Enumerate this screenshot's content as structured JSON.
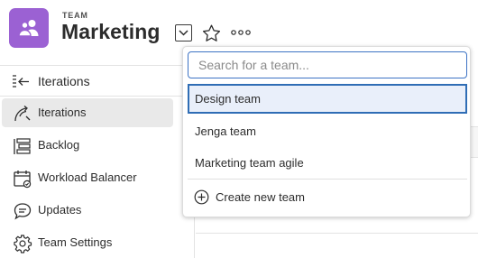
{
  "header": {
    "kicker": "TEAM",
    "title": "Marketing",
    "avatar_color": "#9b61d3"
  },
  "sidebar": {
    "heading": "Iterations",
    "items": [
      {
        "label": "Iterations",
        "icon": "iterations-icon",
        "active": true
      },
      {
        "label": "Backlog",
        "icon": "backlog-icon",
        "active": false
      },
      {
        "label": "Workload Balancer",
        "icon": "calendar-check-icon",
        "active": false
      },
      {
        "label": "Updates",
        "icon": "speech-bubble-icon",
        "active": false
      },
      {
        "label": "Team Settings",
        "icon": "gear-icon",
        "active": false
      }
    ]
  },
  "team_picker": {
    "search_placeholder": "Search for a team...",
    "options": [
      {
        "label": "Design team",
        "selected": true
      },
      {
        "label": "Jenga team",
        "selected": false
      },
      {
        "label": "Marketing team agile",
        "selected": false
      }
    ],
    "create_label": "Create new team"
  },
  "colors": {
    "accent": "#2f6db5",
    "selected_bg": "#e9effa",
    "sidebar_active_bg": "#e9e9e9"
  }
}
